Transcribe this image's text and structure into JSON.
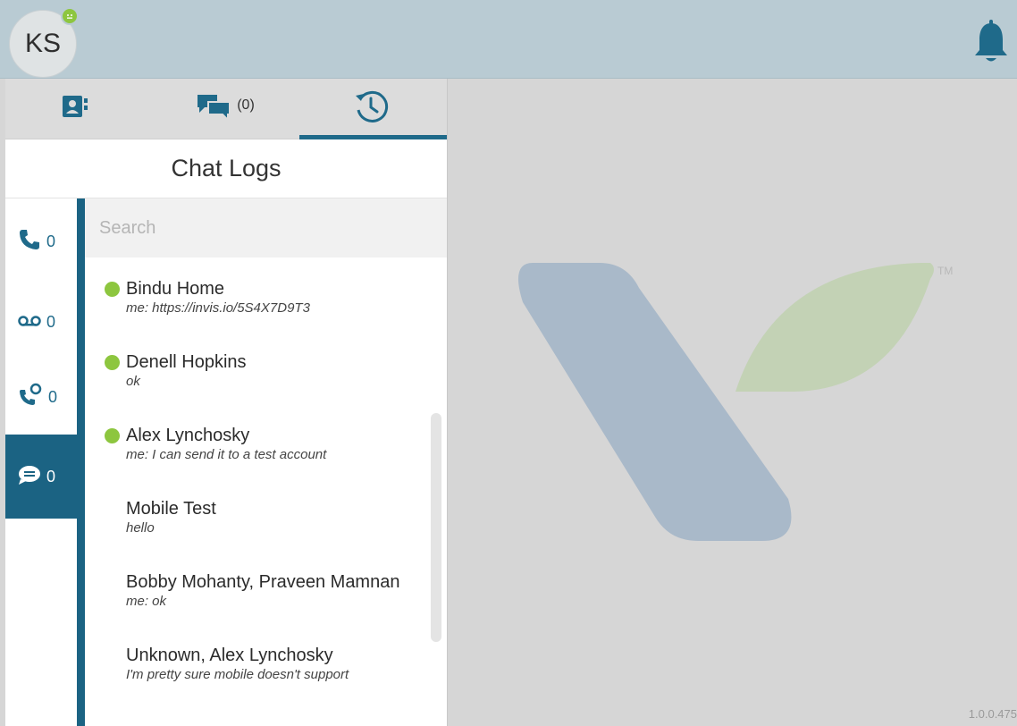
{
  "user": {
    "initials": "KS",
    "presence": "online"
  },
  "tabs": [
    {
      "name": "contacts",
      "icon": "contact-card-icon",
      "count": ""
    },
    {
      "name": "messages",
      "icon": "chat-bubbles-icon",
      "count": "(0)"
    },
    {
      "name": "history",
      "icon": "history-clock-icon",
      "count": ""
    }
  ],
  "panel": {
    "title": "Chat Logs"
  },
  "filters": [
    {
      "icon": "phone-icon",
      "count": "0"
    },
    {
      "icon": "voicemail-icon",
      "count": "0"
    },
    {
      "icon": "missed-call-icon",
      "count": "0"
    },
    {
      "icon": "chat-icon",
      "count": "0"
    }
  ],
  "search": {
    "placeholder": "Search"
  },
  "chats": [
    {
      "name": "Bindu Home",
      "preview": "me: https://invis.io/5S4X7D9T3",
      "online": true
    },
    {
      "name": "Denell Hopkins",
      "preview": "ok",
      "online": true
    },
    {
      "name": "Alex Lynchosky",
      "preview": "me: I can send it to a test account",
      "online": true
    },
    {
      "name": "Mobile Test",
      "preview": "hello",
      "online": false
    },
    {
      "name": "Bobby Mohanty, Praveen Mamnan",
      "preview": "me: ok",
      "online": false
    },
    {
      "name": "Unknown, Alex Lynchosky",
      "preview": "I'm pretty sure mobile doesn't support",
      "online": false
    }
  ],
  "brand": {
    "tm": "TM",
    "version": "1.0.0.475",
    "color_blue": "#a9b9c9",
    "color_green": "#c3d2b5"
  },
  "colors": {
    "accent": "#1b6383",
    "online": "#8dc63f",
    "topbar": "#b9cbd3"
  }
}
